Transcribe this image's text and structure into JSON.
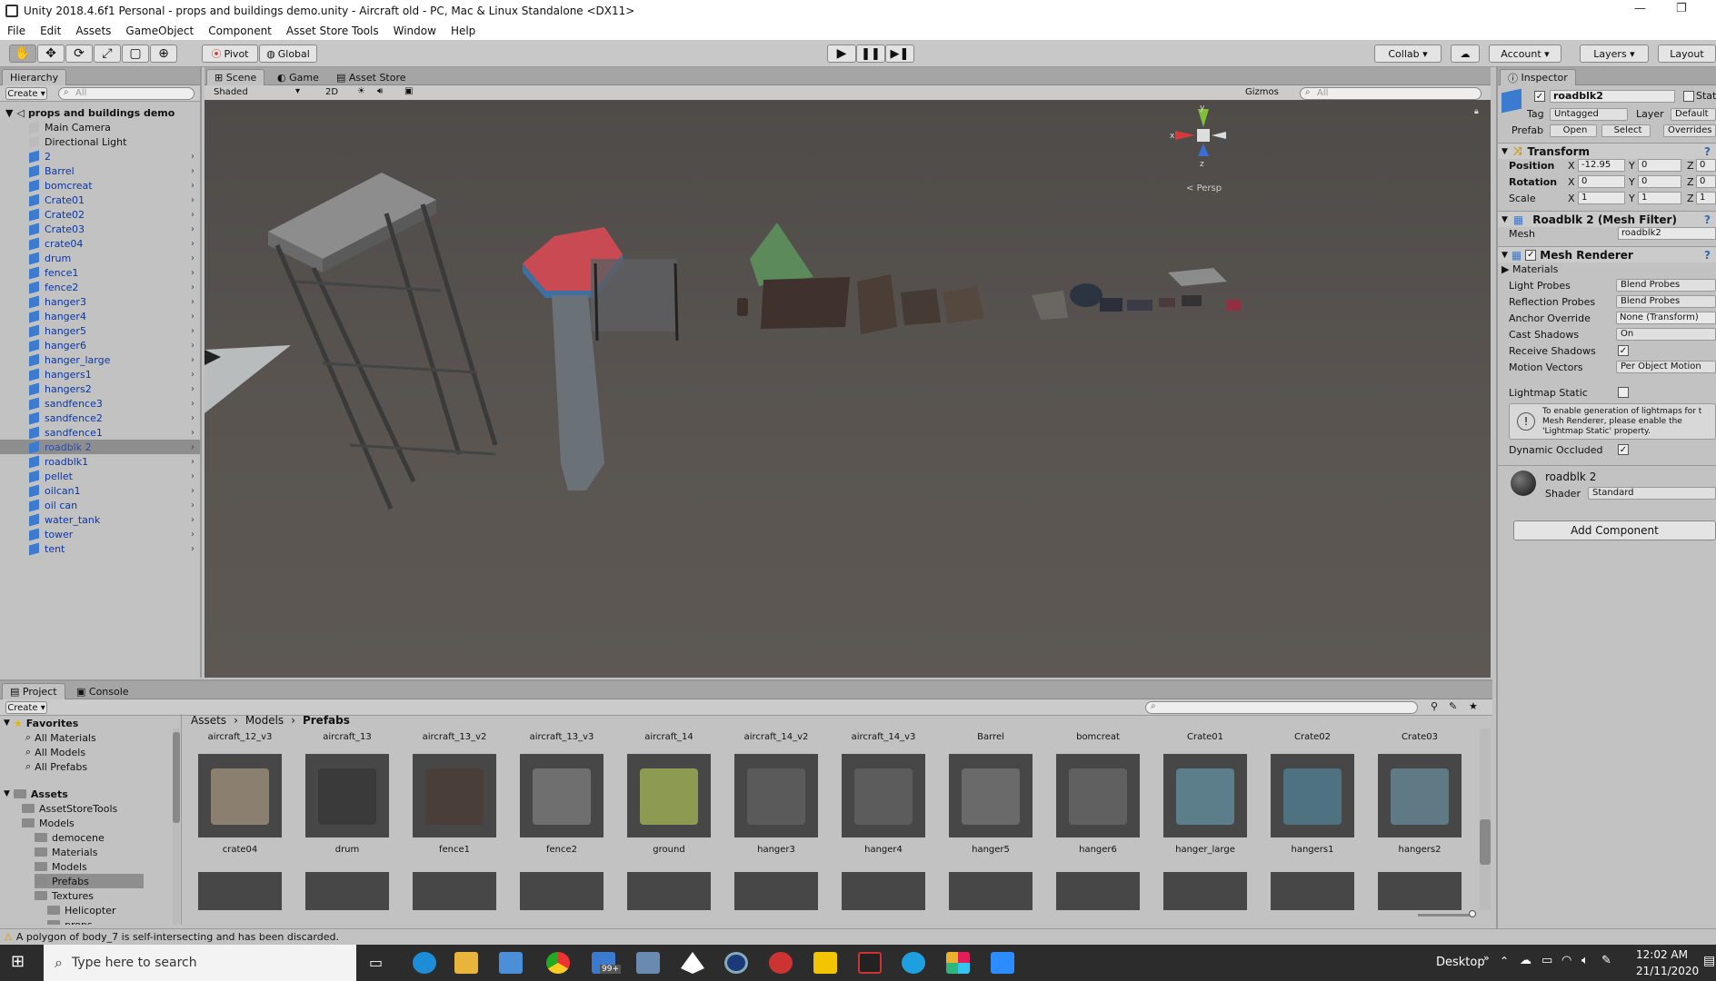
{
  "window": {
    "title": "Unity 2018.4.6f1 Personal - props and buildings demo.unity - Aircraft old - PC, Mac & Linux Standalone <DX11>",
    "min": "—",
    "max": "❐"
  },
  "menu": [
    "File",
    "Edit",
    "Assets",
    "GameObject",
    "Component",
    "Asset Store Tools",
    "Window",
    "Help"
  ],
  "toolbar": {
    "pivot": "Pivot",
    "global": "Global",
    "collab": "Collab",
    "account": "Account",
    "layers": "Layers",
    "layout": "Layout"
  },
  "hierarchy": {
    "tab": "Hierarchy",
    "create": "Create",
    "search_placeholder": "All",
    "scene": "props and buildings demo",
    "plain_items": [
      "Main Camera",
      "Directional Light"
    ],
    "items": [
      "2",
      "Barrel",
      "bomcreat",
      "Crate01",
      "Crate02",
      "Crate03",
      "crate04",
      "drum",
      "fence1",
      "fence2",
      "hanger3",
      "hanger4",
      "hanger5",
      "hanger6",
      "hanger_large",
      "hangers1",
      "hangers2",
      "sandfence3",
      "sandfence2",
      "sandfence1",
      "roadblk 2",
      "roadblk1",
      "pellet",
      "oilcan1",
      "oil can",
      "water_tank",
      "tower",
      "tent"
    ],
    "selected": "roadblk 2"
  },
  "scene_view": {
    "tabs": [
      "Scene",
      "Game",
      "Asset Store"
    ],
    "shading": "Shaded",
    "mode_2d": "2D",
    "gizmos": "Gizmos",
    "search_placeholder": "All",
    "gizmo_label": "Persp",
    "axis_y": "y",
    "axis_x": "x",
    "axis_z": "z"
  },
  "inspector": {
    "tab": "Inspector",
    "name": "roadblk2",
    "static": "Stat",
    "tag_label": "Tag",
    "tag_value": "Untagged",
    "layer_label": "Layer",
    "layer_value": "Default",
    "prefab_label": "Prefab",
    "open": "Open",
    "select": "Select",
    "overrides": "Overrides",
    "transform": "Transform",
    "position_label": "Position",
    "rotation_label": "Rotation",
    "scale_label": "Scale",
    "pos_x": "-12.95",
    "pos_y": "0",
    "pos_z": "0",
    "rot_x": "0",
    "rot_y": "0",
    "rot_z": "0",
    "scl_x": "1",
    "scl_y": "1",
    "scl_z": "1",
    "mesh_filter": "Roadblk 2 (Mesh Filter)",
    "mesh_label": "Mesh",
    "mesh_value": "roadblk2",
    "mesh_renderer": "Mesh Renderer",
    "materials": "Materials",
    "light_probes_label": "Light Probes",
    "light_probes": "Blend Probes",
    "reflection_probes_label": "Reflection Probes",
    "reflection_probes": "Blend Probes",
    "anchor_label": "Anchor Override",
    "anchor": "None (Transform)",
    "cast_label": "Cast Shadows",
    "cast": "On",
    "receive_label": "Receive Shadows",
    "motion_label": "Motion Vectors",
    "motion": "Per Object Motion",
    "lightmap_label": "Lightmap Static",
    "info": "To enable generation of lightmaps for t Mesh Renderer, please enable the 'Lightmap Static' property.",
    "dynamic_label": "Dynamic Occluded",
    "material_name": "roadblk 2",
    "shader_label": "Shader",
    "shader": "Standard",
    "add_component": "Add Component"
  },
  "project": {
    "tabs": [
      "Project",
      "Console"
    ],
    "create": "Create",
    "breadcrumb": [
      "Assets",
      "Models",
      "Prefabs"
    ],
    "favorites": "Favorites",
    "fav_items": [
      "All Materials",
      "All Models",
      "All Prefabs"
    ],
    "assets": "Assets",
    "tree": [
      {
        "label": "AssetStoreTools",
        "indent": 1
      },
      {
        "label": "Models",
        "indent": 1
      },
      {
        "label": "democene",
        "indent": 2
      },
      {
        "label": "Materials",
        "indent": 2
      },
      {
        "label": "Models",
        "indent": 2
      },
      {
        "label": "Prefabs",
        "indent": 2
      },
      {
        "label": "Textures",
        "indent": 2
      },
      {
        "label": "Helicopter",
        "indent": 3
      },
      {
        "label": "props",
        "indent": 3
      }
    ],
    "top_labels": [
      "aircraft_12_v3",
      "aircraft_13",
      "aircraft_13_v2",
      "aircraft_13_v3",
      "aircraft_14",
      "aircraft_14_v2",
      "aircraft_14_v3",
      "Barrel",
      "bomcreat",
      "Crate01",
      "Crate02",
      "Crate03"
    ],
    "row_labels": [
      "crate04",
      "drum",
      "fence1",
      "fence2",
      "ground",
      "hanger3",
      "hanger4",
      "hanger5",
      "hanger6",
      "hanger_large",
      "hangers1",
      "hangers2"
    ],
    "thumb_colors": [
      "#8b8070",
      "#3a3a3a",
      "#4a3e38",
      "#6f6f6f",
      "#8d9a52",
      "#5a5a5a",
      "#5c5c5c",
      "#6a6a6a",
      "#606060",
      "#5c7d8a",
      "#4e7280",
      "#5f7a84"
    ]
  },
  "status": {
    "message": "A polygon of body_7 is self-intersecting and has been discarded."
  },
  "taskbar": {
    "search_placeholder": "Type here to search",
    "badge": "99+",
    "desktop": "Desktop",
    "time": "12:02 AM",
    "date": "21/11/2020"
  }
}
